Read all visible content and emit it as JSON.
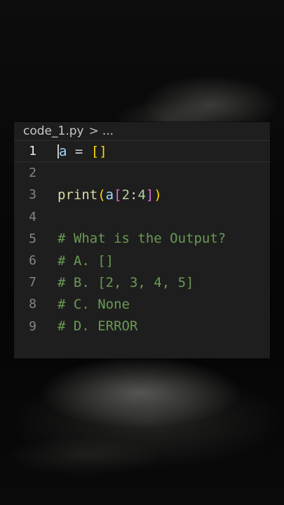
{
  "breadcrumb": {
    "file": "code_1.py",
    "separator": ">",
    "more": "..."
  },
  "code_lines": [
    {
      "number": "1",
      "var": "a",
      "op": " = ",
      "open": "[",
      "close": "]"
    },
    {
      "number": "2"
    },
    {
      "number": "3",
      "fn": "print",
      "open_paren": "(",
      "var": "a",
      "open_br": "[",
      "num1": "2",
      "colon": ":",
      "num2": "4",
      "close_br": "]",
      "close_paren": ")"
    },
    {
      "number": "4"
    },
    {
      "number": "5",
      "comment": "# What is the Output?"
    },
    {
      "number": "6",
      "comment": "# A. []"
    },
    {
      "number": "7",
      "comment": "# B. [2, 3, 4, 5]"
    },
    {
      "number": "8",
      "comment": "# C. None"
    },
    {
      "number": "9",
      "comment": "# D. ERROR"
    }
  ],
  "colors": {
    "editor_bg": "#1e1e1e",
    "variable": "#9cdcfe",
    "function": "#dcdcaa",
    "number": "#b5cea8",
    "comment": "#6a9955",
    "bracket_level1": "#ffd700",
    "bracket_level2": "#da70d6"
  }
}
